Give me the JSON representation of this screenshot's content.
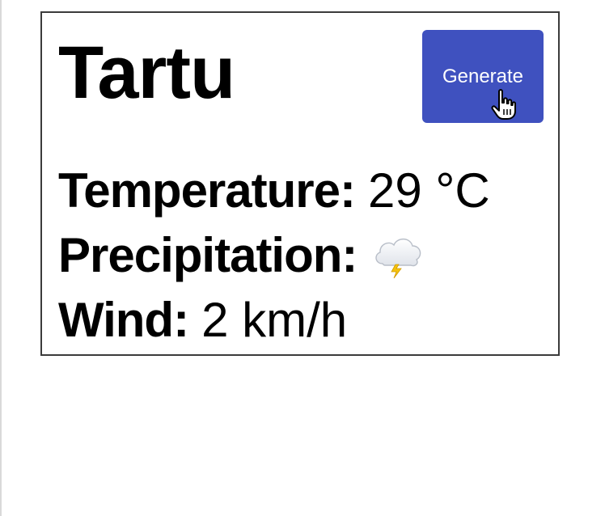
{
  "weather": {
    "city": "Tartu",
    "generate_label": "Generate",
    "rows": [
      {
        "label": "Temperature:",
        "value": "29 °C"
      },
      {
        "label": "Precipitation:",
        "icon": "thunder-cloud-icon"
      },
      {
        "label": "Wind:",
        "value": "2 km/h"
      }
    ]
  },
  "colors": {
    "button": "#3f51bf",
    "button_text": "#ffffff",
    "border": "#3b3b3b"
  },
  "icons": {
    "cursor": "hand-pointer-icon",
    "precipitation": "thunder-cloud-icon"
  }
}
